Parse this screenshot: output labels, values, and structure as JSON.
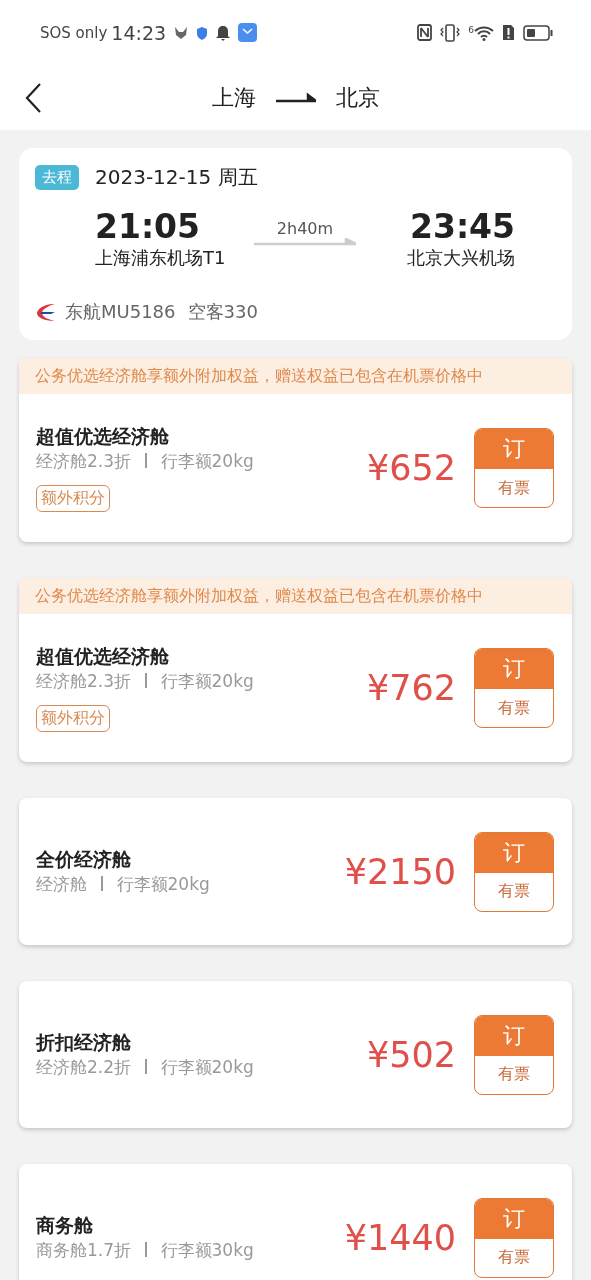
{
  "status_bar": {
    "carrier": "SOS only",
    "time": "14:23",
    "wifi_badge": "6"
  },
  "header": {
    "from": "上海",
    "to": "北京"
  },
  "flight": {
    "tag": "去程",
    "date": "2023-12-15 周五",
    "depart_time": "21:05",
    "depart_airport": "上海浦东机场T1",
    "duration": "2h40m",
    "arrive_time": "23:45",
    "arrive_airport": "北京大兴机场",
    "flight_no": "东航MU5186",
    "aircraft": "空客330"
  },
  "fares": [
    {
      "notice": "公务优选经济舱享额外附加权益，赠送权益已包含在机票价格中",
      "name": "超值优选经济舱",
      "discount": "经济舱2.3折",
      "baggage": "行李额20kg",
      "badge": "额外积分",
      "price": "¥652",
      "book": "订",
      "availability": "有票"
    },
    {
      "notice": "公务优选经济舱享额外附加权益，赠送权益已包含在机票价格中",
      "name": "超值优选经济舱",
      "discount": "经济舱2.3折",
      "baggage": "行李额20kg",
      "badge": "额外积分",
      "price": "¥762",
      "book": "订",
      "availability": "有票"
    },
    {
      "name": "全价经济舱",
      "discount": "经济舱",
      "baggage": "行李额20kg",
      "price": "¥2150",
      "book": "订",
      "availability": "有票"
    },
    {
      "name": "折扣经济舱",
      "discount": "经济舱2.2折",
      "baggage": "行李额20kg",
      "price": "¥502",
      "book": "订",
      "availability": "有票"
    },
    {
      "name": "商务舱",
      "discount": "商务舱1.7折",
      "baggage": "行李额30kg",
      "price": "¥1440",
      "book": "订",
      "availability": "有票"
    }
  ]
}
